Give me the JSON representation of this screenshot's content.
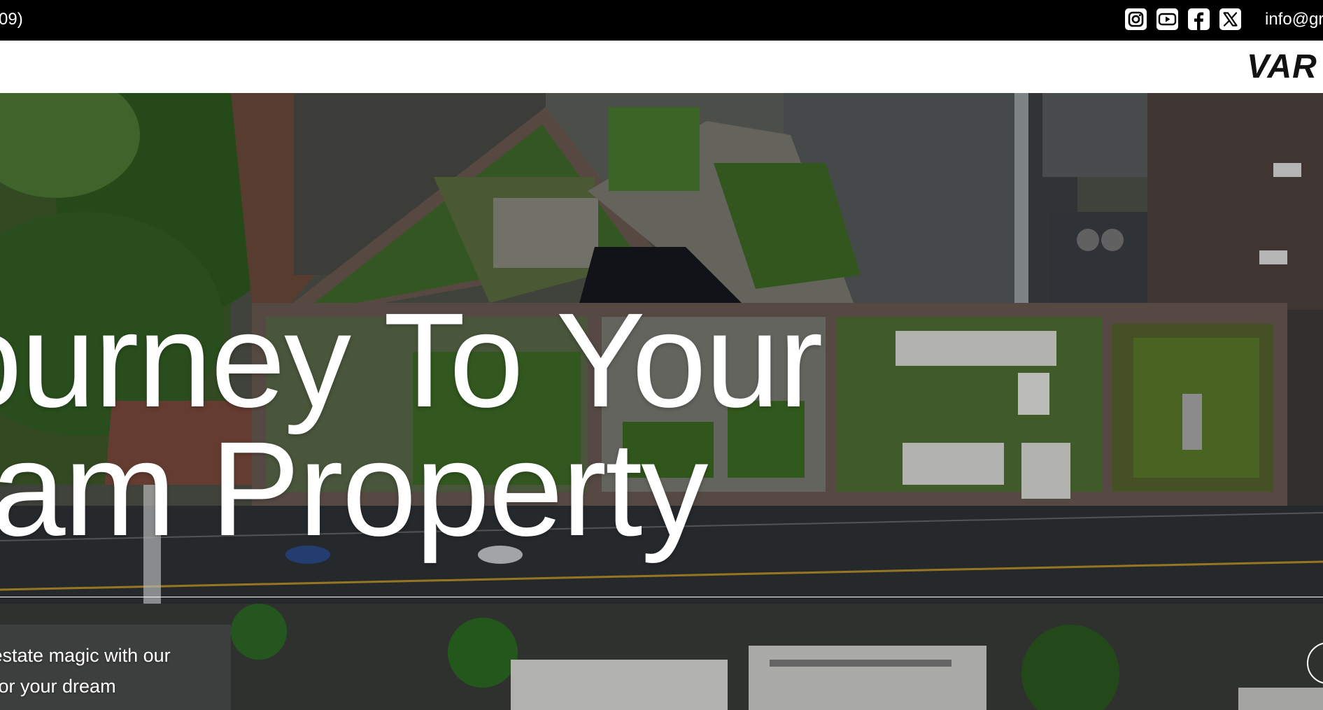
{
  "topbar": {
    "phone": "09)",
    "email": "info@gre",
    "socials": [
      {
        "icon": "instagram-icon"
      },
      {
        "icon": "youtube-icon"
      },
      {
        "icon": "facebook-icon"
      },
      {
        "icon": "x-twitter-icon"
      }
    ]
  },
  "navbar": {
    "logo": "VAR"
  },
  "hero": {
    "title_line1": "ourney To Your",
    "title_line2": "ream Property",
    "subtitle_line1": "al estate magic with our",
    "subtitle_line2": "m for your dream"
  },
  "colors": {
    "topbar_bg": "#000000",
    "navbar_bg": "#ffffff",
    "hero_text": "#ffffff"
  }
}
